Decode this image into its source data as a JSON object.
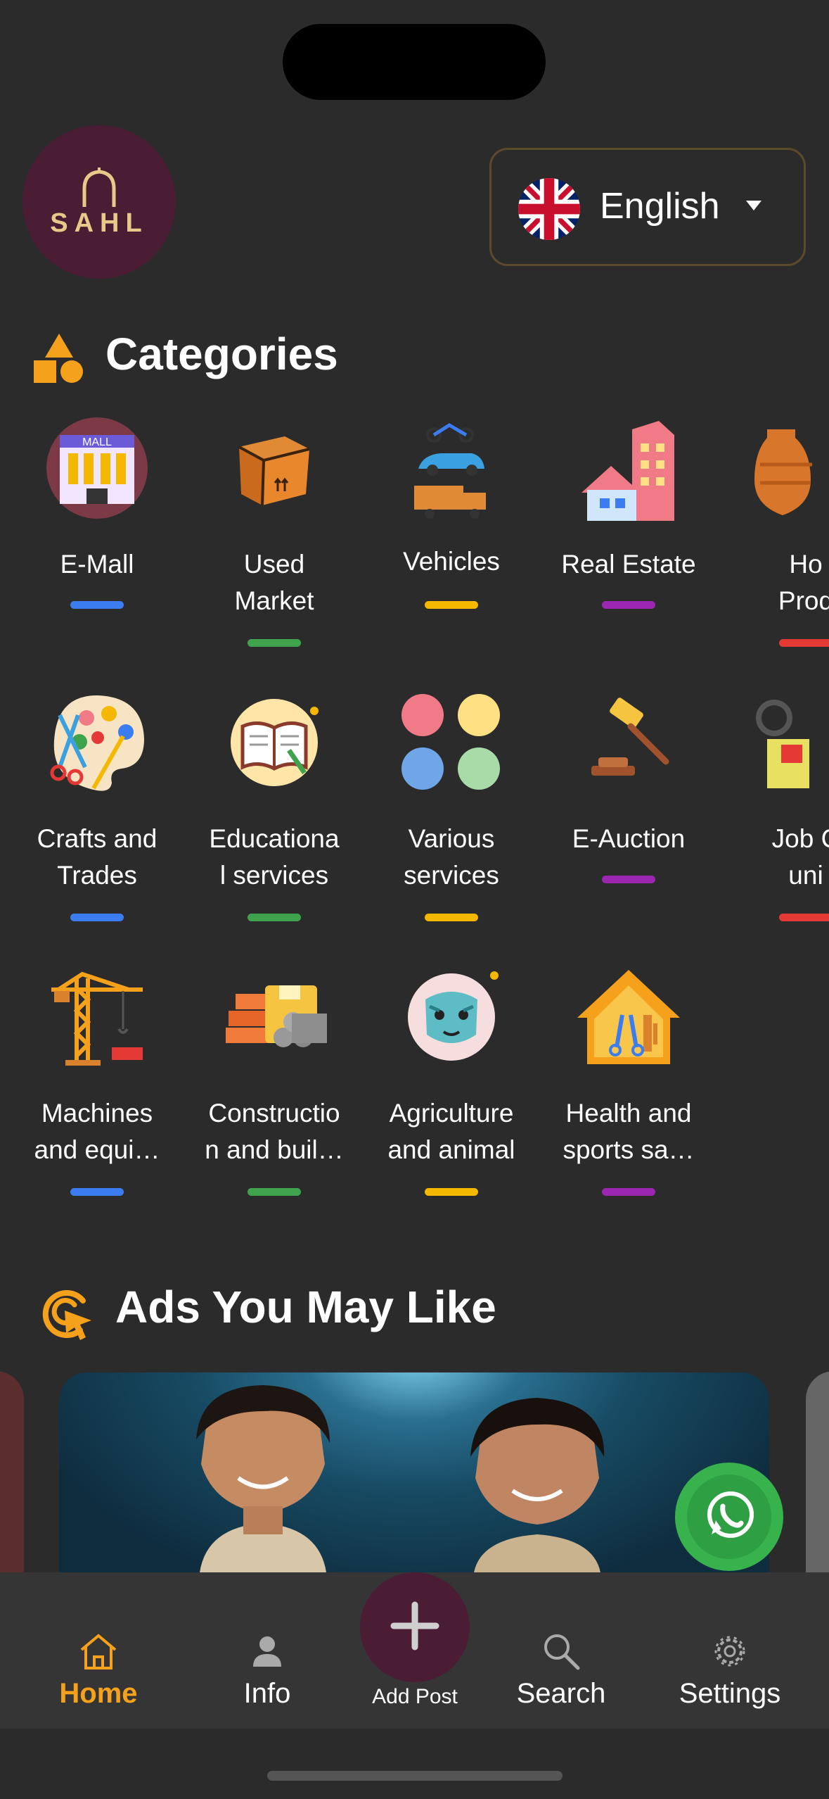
{
  "brand": {
    "logo_text": "SAHL"
  },
  "language": {
    "selected": "English"
  },
  "categories": {
    "title": "Categories",
    "items": [
      {
        "label": "E-Mall",
        "icon": "mall-icon",
        "color": "#3b7df0"
      },
      {
        "label": "Used\nMarket",
        "icon": "cardboard-box-icon",
        "color": "#3fa34d"
      },
      {
        "label": "Vehicles",
        "icon": "vehicles-icon",
        "color": "#f5b800"
      },
      {
        "label": "Real Estate",
        "icon": "buildings-icon",
        "color": "#9b27b0"
      },
      {
        "label": "Ho\nProd",
        "icon": "vase-icon",
        "color": "#e53935"
      },
      {
        "label": "Crafts and\nTrades",
        "icon": "palette-icon",
        "color": "#3b7df0"
      },
      {
        "label": "Educationa\nl services",
        "icon": "book-icon",
        "color": "#3fa34d"
      },
      {
        "label": "Various\nservices",
        "icon": "circles-icon",
        "color": "#f5b800"
      },
      {
        "label": "E-Auction",
        "icon": "gavel-icon",
        "color": "#9b27b0"
      },
      {
        "label": "Job C\nuni",
        "icon": "job-icon",
        "color": "#e53935"
      },
      {
        "label": "Machines\nand equi…",
        "icon": "crane-icon",
        "color": "#3b7df0"
      },
      {
        "label": "Constructio\nn and buil…",
        "icon": "bricks-icon",
        "color": "#3fa34d"
      },
      {
        "label": "Agriculture\nand animal",
        "icon": "animal-icon",
        "color": "#f5b800"
      },
      {
        "label": "Health and\nsports sa…",
        "icon": "health-icon",
        "color": "#9b27b0"
      }
    ]
  },
  "ads": {
    "title": "Ads You May Like"
  },
  "nav": {
    "home": "Home",
    "info": "Info",
    "add_post": "Add Post",
    "search": "Search",
    "settings": "Settings",
    "active_color": "#f5a11c"
  }
}
